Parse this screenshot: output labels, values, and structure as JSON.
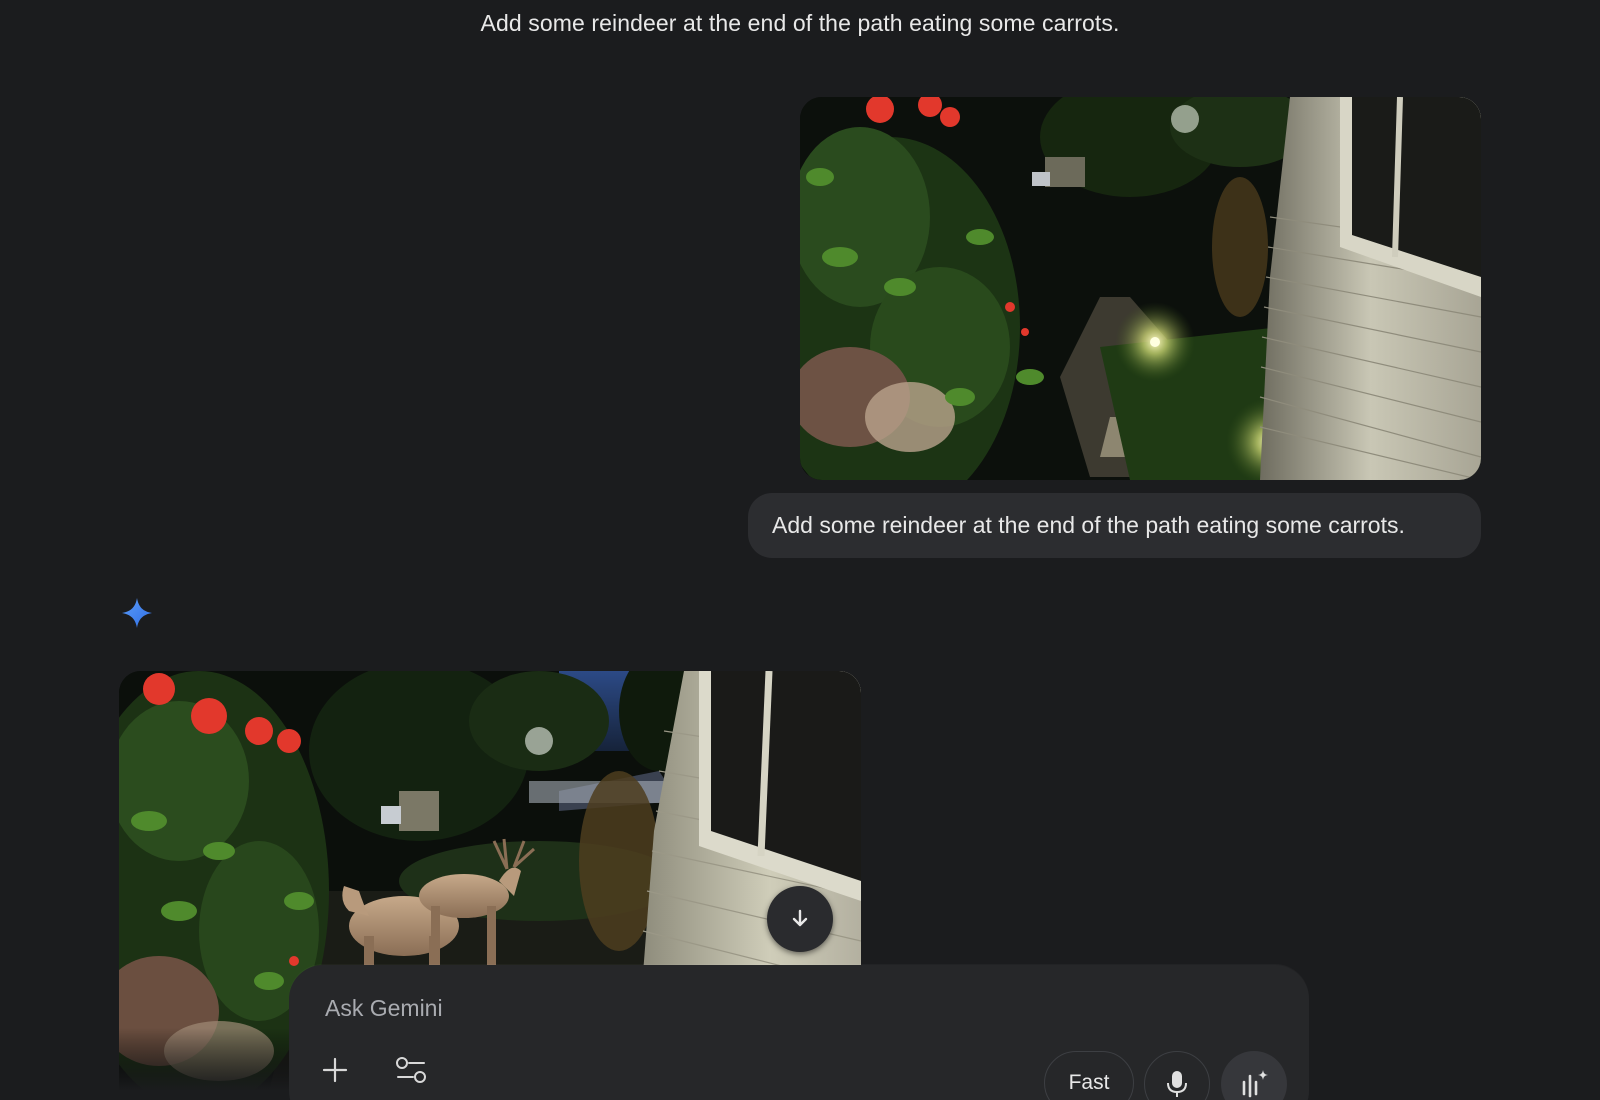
{
  "conversation": {
    "title": "Add some reindeer at the end of the path eating some carrots.",
    "user_message": {
      "text": "Add some reindeer at the end of the path eating some carrots."
    },
    "response": {
      "icon": "gemini-sparkle-icon",
      "download_icon": "arrow-down-icon"
    }
  },
  "composer": {
    "placeholder": "Ask Gemini",
    "add_icon": "plus-icon",
    "tools_icon": "tools-sliders-icon",
    "mode_label": "Fast",
    "mic_icon": "microphone-icon",
    "live_icon": "live-audio-icon"
  },
  "colors": {
    "background": "#1b1c1e",
    "bubble": "#2c2d30",
    "composer": "#262729",
    "accent": "#4a8af4"
  }
}
